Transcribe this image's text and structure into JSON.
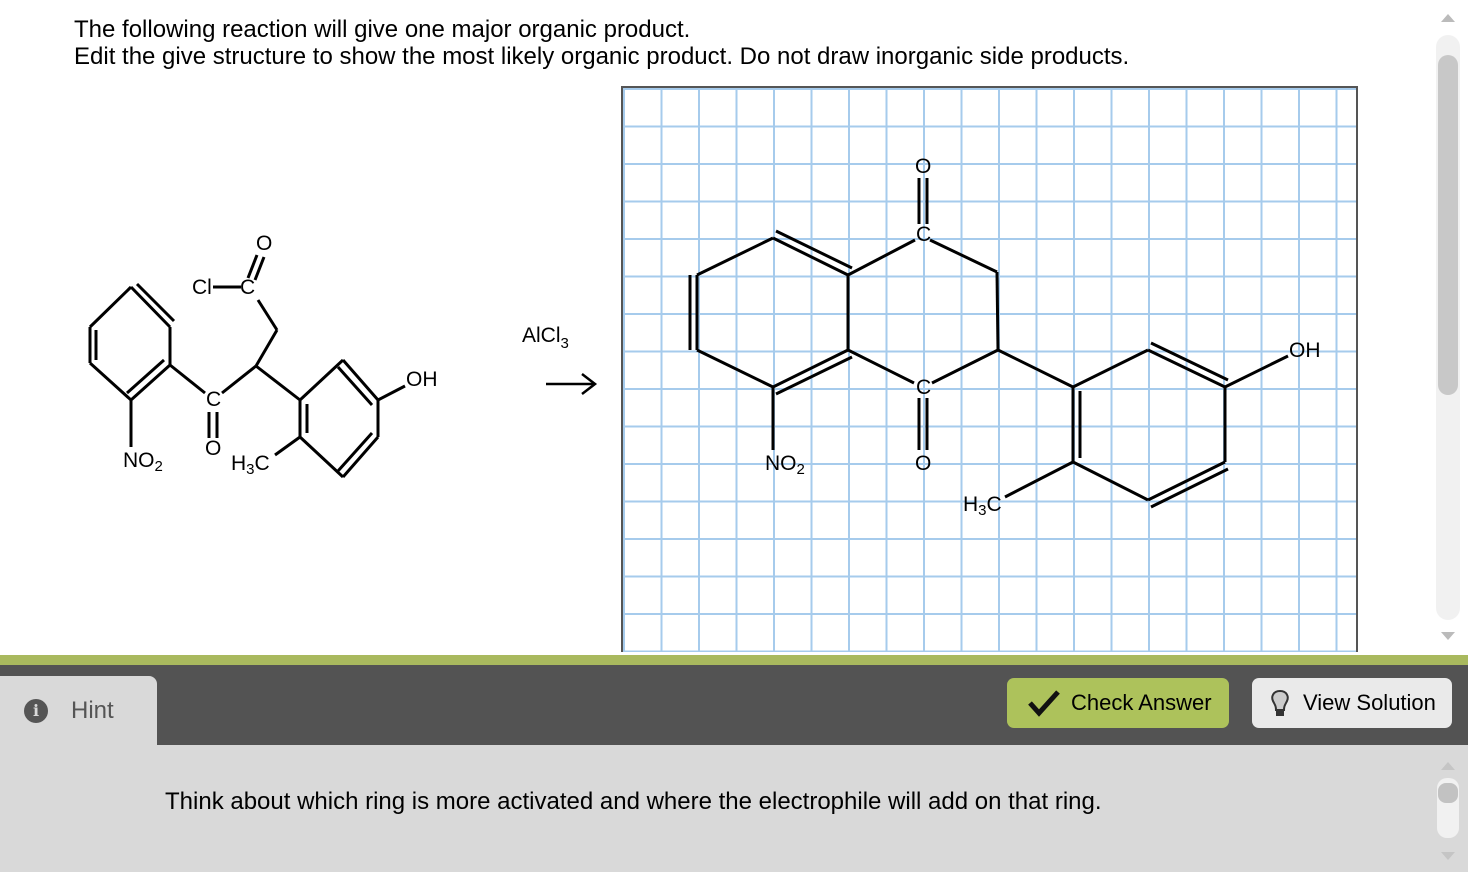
{
  "question": {
    "line1": "The following reaction will give one major organic product.",
    "line2": "Edit the give structure to show the most likely organic product.  Do not draw inorganic side products."
  },
  "reactant": {
    "labels": {
      "cl": "Cl",
      "c_acyl": "C",
      "o_acyl": "O",
      "c_keto": "C",
      "o_keto": "O",
      "no2": "NO",
      "no2_sub": "2",
      "oh": "OH",
      "h3c_h": "H",
      "h3c_sub": "3",
      "h3c_c": "C"
    }
  },
  "reagent": {
    "text": "AlCl",
    "sub": "3",
    "arrow": "→"
  },
  "product": {
    "labels": {
      "c_top": "C",
      "o_top": "O",
      "c_bot": "C",
      "o_bot": "O",
      "no2": "NO",
      "no2_sub": "2",
      "oh": "OH",
      "h3c_h": "H",
      "h3c_sub": "3",
      "h3c_c": "C"
    }
  },
  "colors": {
    "accent_green": "#adc25b",
    "bar_green": "#a9b95e",
    "dark_bar": "#535353",
    "grid_line": "#a6cbec"
  },
  "footer": {
    "hint_icon": "info-icon",
    "hint_label": "Hint",
    "check_icon": "checkmark-icon",
    "check_label": "Check Answer",
    "view_icon": "lightbulb-icon",
    "view_label": "View Solution",
    "hint_text": "Think about which ring is more activated and where the electrophile will add on that ring."
  }
}
